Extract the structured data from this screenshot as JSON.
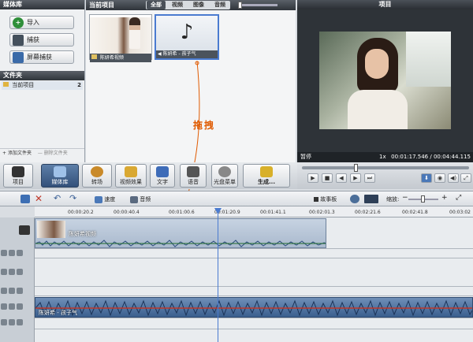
{
  "media_panel": {
    "title": "媒体库",
    "import_label": "导入",
    "capture_label": "捕获",
    "screen_capture_label": "屏幕捕获",
    "folders_title": "文件夹",
    "current_project_label": "当前项目",
    "current_project_count": "2",
    "add_folder_label": "添加文件夹",
    "remove_folder_label": "删除文件夹"
  },
  "project_panel": {
    "title": "当前项目",
    "tabs": [
      "全部",
      "视频",
      "图像",
      "音频"
    ],
    "active_tab": "全部",
    "items": [
      {
        "label": "陈妍希视频",
        "type": "video"
      },
      {
        "label": "陈妍希 - 孩子气",
        "type": "audio"
      }
    ]
  },
  "annotation": {
    "drag_label": "拖拽",
    "color": "#e05a00"
  },
  "preview": {
    "title": "项目",
    "status_label": "暂停",
    "speed": "1x",
    "current_time": "00:01:17.546",
    "total_time": "00:04:44.115",
    "time_separator": "/"
  },
  "toolbar": {
    "items": [
      {
        "label": "项目",
        "icon": "clapper-icon"
      },
      {
        "label": "媒体库",
        "icon": "grid-icon",
        "active": true
      },
      {
        "label": "转场",
        "icon": "transition-icon"
      },
      {
        "label": "视频效果",
        "icon": "fx-icon"
      },
      {
        "label": "文字",
        "icon": "text-icon"
      },
      {
        "label": "语音",
        "icon": "microphone-icon"
      },
      {
        "label": "光盘菜单",
        "icon": "disc-icon"
      },
      {
        "label": "生成...",
        "icon": "generate-icon"
      }
    ]
  },
  "timeline_toolbar": {
    "speed_label": "速度",
    "audio_label": "音频",
    "storyboard_label": "故事板",
    "zoom_label": "缩放:"
  },
  "ruler": [
    "00:00:20.2",
    "00:00:40.4",
    "00:01:00.6",
    "00:01:20.9",
    "00:01:41.1",
    "00:02:01.3",
    "00:02:21.6",
    "00:02:41.8",
    "00:03:02"
  ],
  "tracks": {
    "video_clip_label": "陈妍希视频",
    "audio_clip_label": "陈妍希 - 孩子气"
  },
  "colors": {
    "accent": "#3b5f8e",
    "audio_wave": "#2f4f7f",
    "playhead": "#4a7bd0"
  }
}
